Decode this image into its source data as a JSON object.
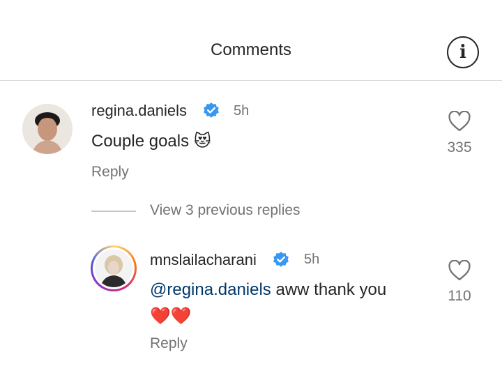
{
  "header": {
    "title": "Comments",
    "info_icon": "info-icon"
  },
  "comments": [
    {
      "username": "regina.daniels",
      "verified": true,
      "time": "5h",
      "text": "Couple goals",
      "emoji": "😻",
      "reply_label": "Reply",
      "likes": "335"
    }
  ],
  "view_replies": "View 3 previous replies",
  "reply": {
    "username": "mnslailacharani",
    "verified": true,
    "time": "5h",
    "mention": "@regina.daniels",
    "text": " aww thank you",
    "emoji": "❤️❤️",
    "reply_label": "Reply",
    "likes": "110"
  },
  "colors": {
    "verified_blue": "#3897f0",
    "secondary_text": "#737373",
    "mention": "#00376b"
  }
}
